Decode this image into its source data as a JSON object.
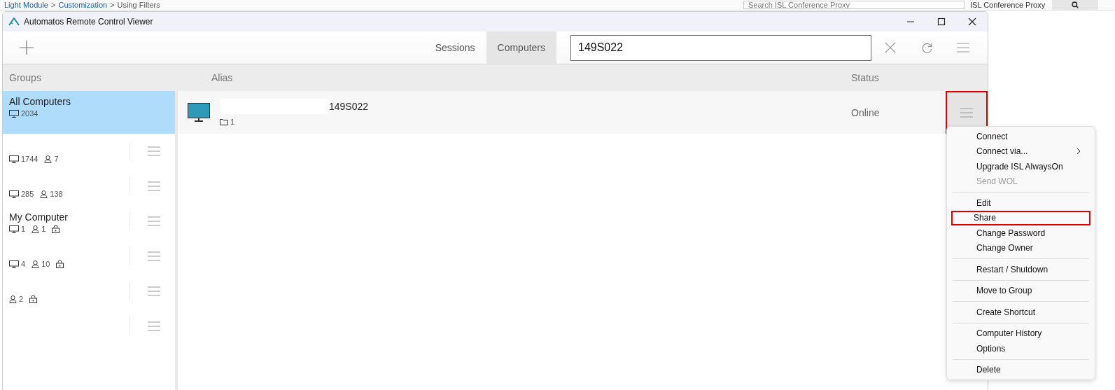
{
  "background_page": {
    "breadcrumb": [
      {
        "label": "Light Module",
        "separator": ">"
      },
      {
        "label": "Customization",
        "separator": ">"
      },
      {
        "label": "Using Filters"
      }
    ],
    "search": {
      "placeholder": "Search ISL Conference Proxy"
    },
    "product_select": {
      "value": "ISL Conference Proxy"
    }
  },
  "window": {
    "title": "Automatos Remote Control Viewer"
  },
  "tabs": [
    {
      "label": "Sessions",
      "selected": false
    },
    {
      "label": "Computers",
      "selected": true
    }
  ],
  "search": {
    "value": "149S022"
  },
  "columns": {
    "groups": "Groups",
    "alias": "Alias",
    "status": "Status"
  },
  "groups": [
    {
      "name": "All Computers",
      "computers": "2034",
      "selected": true,
      "locked": false,
      "has_menu": false
    },
    {
      "computers": "1744",
      "users": "7",
      "selected": false,
      "locked": false,
      "has_menu": true
    },
    {
      "computers": "285",
      "users": "138",
      "selected": false,
      "locked": false,
      "has_menu": true
    },
    {
      "name": "My Computer",
      "computers": "1",
      "users": "1",
      "selected": false,
      "locked": true,
      "has_menu": true
    },
    {
      "computers": "4",
      "users": "10",
      "selected": false,
      "locked": true,
      "has_menu": true
    },
    {
      "users": "2",
      "selected": false,
      "locked": true,
      "has_menu": true
    },
    {
      "selected": false,
      "locked": false,
      "has_menu": true
    }
  ],
  "computers": [
    {
      "alias": "149S022",
      "folders": "1",
      "status": "Online",
      "menu_highlighted": true
    }
  ],
  "context_menu": [
    {
      "label": "Connect",
      "disabled": false,
      "highlighted": false,
      "submenu": false
    },
    {
      "label": "Connect via...",
      "disabled": false,
      "highlighted": false,
      "submenu": true
    },
    {
      "label": "Upgrade ISL AlwaysOn",
      "disabled": false,
      "highlighted": false,
      "submenu": false
    },
    {
      "label": "Send WOL",
      "disabled": true,
      "highlighted": false,
      "submenu": false
    },
    {
      "kind": "separator"
    },
    {
      "label": "Edit",
      "disabled": false,
      "highlighted": false,
      "submenu": false
    },
    {
      "label": "Share",
      "disabled": false,
      "highlighted": true,
      "submenu": false
    },
    {
      "label": "Change Password",
      "disabled": false,
      "highlighted": false,
      "submenu": false
    },
    {
      "label": "Change Owner",
      "disabled": false,
      "highlighted": false,
      "submenu": false
    },
    {
      "kind": "separator"
    },
    {
      "label": "Restart / Shutdown",
      "disabled": false,
      "highlighted": false,
      "submenu": false
    },
    {
      "kind": "separator"
    },
    {
      "label": "Move to Group",
      "disabled": false,
      "highlighted": false,
      "submenu": false
    },
    {
      "kind": "separator"
    },
    {
      "label": "Create Shortcut",
      "disabled": false,
      "highlighted": false,
      "submenu": false
    },
    {
      "kind": "separator"
    },
    {
      "label": "Computer History",
      "disabled": false,
      "highlighted": false,
      "submenu": false
    },
    {
      "label": "Options",
      "disabled": false,
      "highlighted": false,
      "submenu": false
    },
    {
      "kind": "separator"
    },
    {
      "label": "Delete",
      "disabled": false,
      "highlighted": false,
      "submenu": false
    }
  ]
}
